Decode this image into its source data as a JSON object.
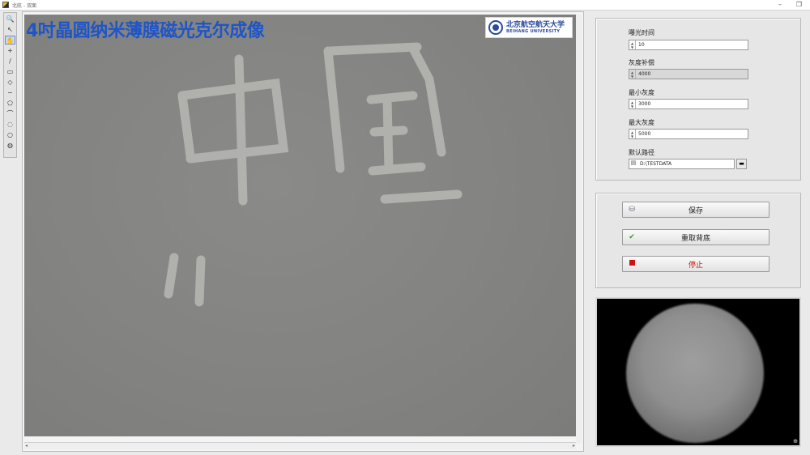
{
  "window": {
    "title": "北航 - 双面",
    "controls": {
      "minimize": "–",
      "restore": "❐"
    }
  },
  "toolbox": {
    "tools": [
      {
        "name": "zoom-tool-icon",
        "glyph": "🔍"
      },
      {
        "name": "pointer-tool-icon",
        "glyph": "↖"
      },
      {
        "name": "pan-tool-icon",
        "glyph": "✋"
      },
      {
        "name": "crosshair-tool-icon",
        "glyph": "+"
      },
      {
        "name": "line-tool-icon",
        "glyph": "/"
      },
      {
        "name": "rectangle-tool-icon",
        "glyph": "▭"
      },
      {
        "name": "rotated-rect-tool-icon",
        "glyph": "◇"
      },
      {
        "name": "freehand-tool-icon",
        "glyph": "~"
      },
      {
        "name": "polygon-tool-icon",
        "glyph": "⬠"
      },
      {
        "name": "curve-tool-icon",
        "glyph": "⌒"
      },
      {
        "name": "annulus-tool-icon",
        "glyph": "◌"
      },
      {
        "name": "oval-tool-icon",
        "glyph": "○"
      },
      {
        "name": "point-tool-icon",
        "glyph": "◍"
      }
    ]
  },
  "viewer": {
    "title": "4吋晶圆纳米薄膜磁光克尔成像",
    "logo": {
      "cn": "北京航空航天大学",
      "en": "BEIHANG UNIVERSITY"
    },
    "scroll": {
      "left": "◂",
      "right": "▸"
    }
  },
  "params": {
    "exposure": {
      "label": "曝光时间",
      "value": "10"
    },
    "gain": {
      "label": "灰度补偿",
      "value": "4000"
    },
    "min_gray": {
      "label": "最小灰度",
      "value": "3000"
    },
    "max_gray": {
      "label": "最大灰度",
      "value": "5000"
    },
    "path": {
      "label": "默认路径",
      "value": "D:\\TESTDATA"
    }
  },
  "buttons": {
    "save": "保存",
    "reacquire": "重取背底",
    "stop": "停止"
  },
  "colors": {
    "title_blue": "#1f55c8",
    "stop_red": "#cc1010"
  }
}
